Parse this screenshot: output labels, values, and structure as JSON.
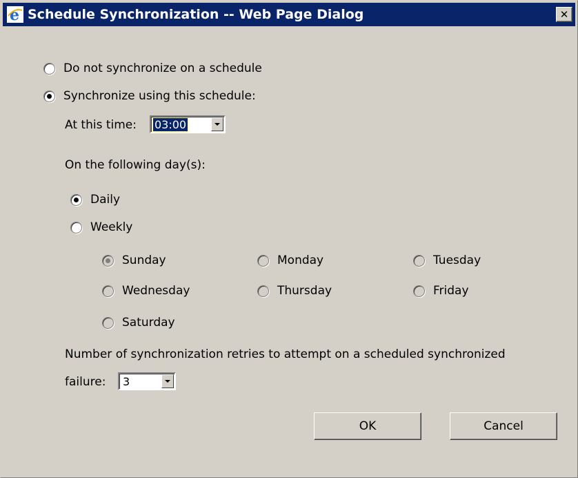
{
  "window": {
    "title": "Schedule Synchronization -- Web Page Dialog",
    "close_label": "✕"
  },
  "schedule_mode": {
    "options": [
      {
        "label": "Do not synchronize on a schedule",
        "checked": false
      },
      {
        "label": "Synchronize using this schedule:",
        "checked": true
      }
    ]
  },
  "time": {
    "label": "At this time:",
    "value": "03:00"
  },
  "days": {
    "label": "On the following day(s):",
    "frequency": [
      {
        "label": "Daily",
        "checked": true
      },
      {
        "label": "Weekly",
        "checked": false
      }
    ],
    "weekdays": [
      {
        "label": "Sunday",
        "checked": true
      },
      {
        "label": "Monday",
        "checked": false
      },
      {
        "label": "Tuesday",
        "checked": false
      },
      {
        "label": "Wednesday",
        "checked": false
      },
      {
        "label": "Thursday",
        "checked": false
      },
      {
        "label": "Friday",
        "checked": false
      },
      {
        "label": "Saturday",
        "checked": false
      }
    ]
  },
  "retries": {
    "label_line1": "Number of synchronization retries to attempt on a scheduled synchronized",
    "label_line2": "failure:",
    "value": "3"
  },
  "buttons": {
    "ok": "OK",
    "cancel": "Cancel"
  },
  "colors": {
    "titlebar": "#0a246a",
    "face": "#d4d0c8",
    "selection": "#0a246a"
  }
}
